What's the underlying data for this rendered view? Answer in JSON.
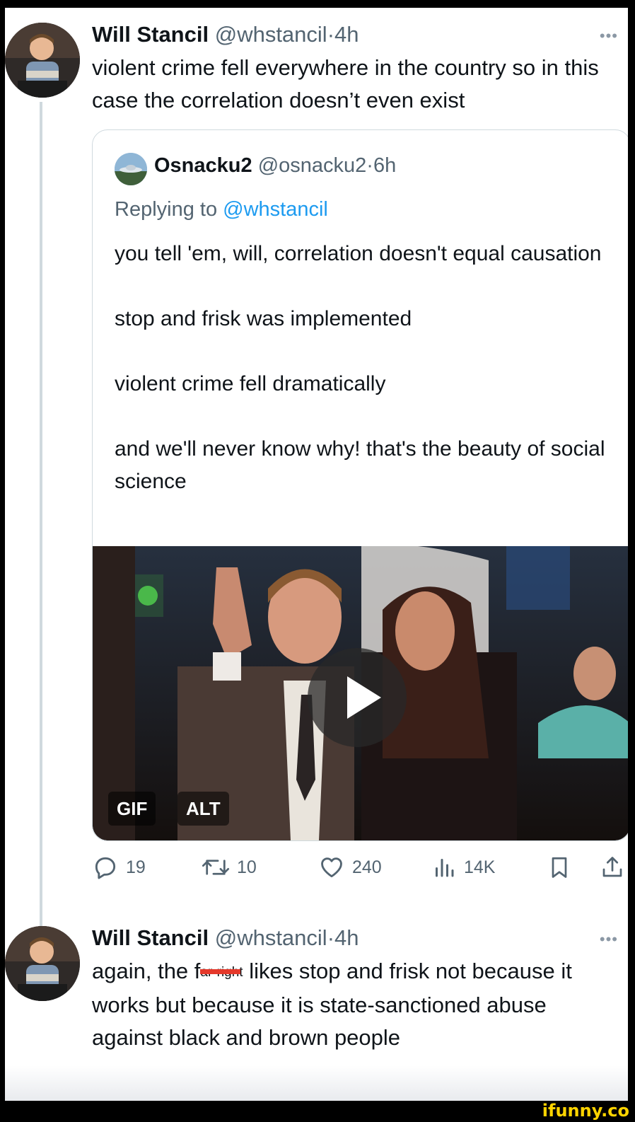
{
  "tweet1": {
    "name": "Will Stancil",
    "handle": "@whstancil",
    "dot": "·",
    "time": "4h",
    "more": "•••",
    "text": "violent crime fell everywhere in the country so in this case the correlation doesn’t even exist"
  },
  "quote": {
    "name": "Osnacku2",
    "handle": "@osnacku2",
    "dot": "·",
    "time": "6h",
    "replying_prefix": "Replying to ",
    "replying_mention": "@whstancil",
    "paragraphs": [
      "you tell 'em, will, correlation doesn't equal causation",
      "stop and frisk was implemented",
      "violent crime fell dramatically",
      "and we'll never know why! that's the beauty of social science"
    ],
    "media": {
      "badge_gif": "GIF",
      "badge_alt": "ALT"
    }
  },
  "actions": {
    "replies": "19",
    "reposts": "10",
    "likes": "240",
    "views": "14K"
  },
  "tweet2": {
    "name": "Will Stancil",
    "handle": "@whstancil",
    "dot": "·",
    "time": "4h",
    "more": "•••",
    "line1_prefix": "again, the f",
    "line1_redacted": "ar-right",
    "line1_suffix": " likes stop and frisk not",
    "text_rest": "because it works but because it is state-sanctioned abuse against black and brown people"
  },
  "watermark": "ifunny.co"
}
